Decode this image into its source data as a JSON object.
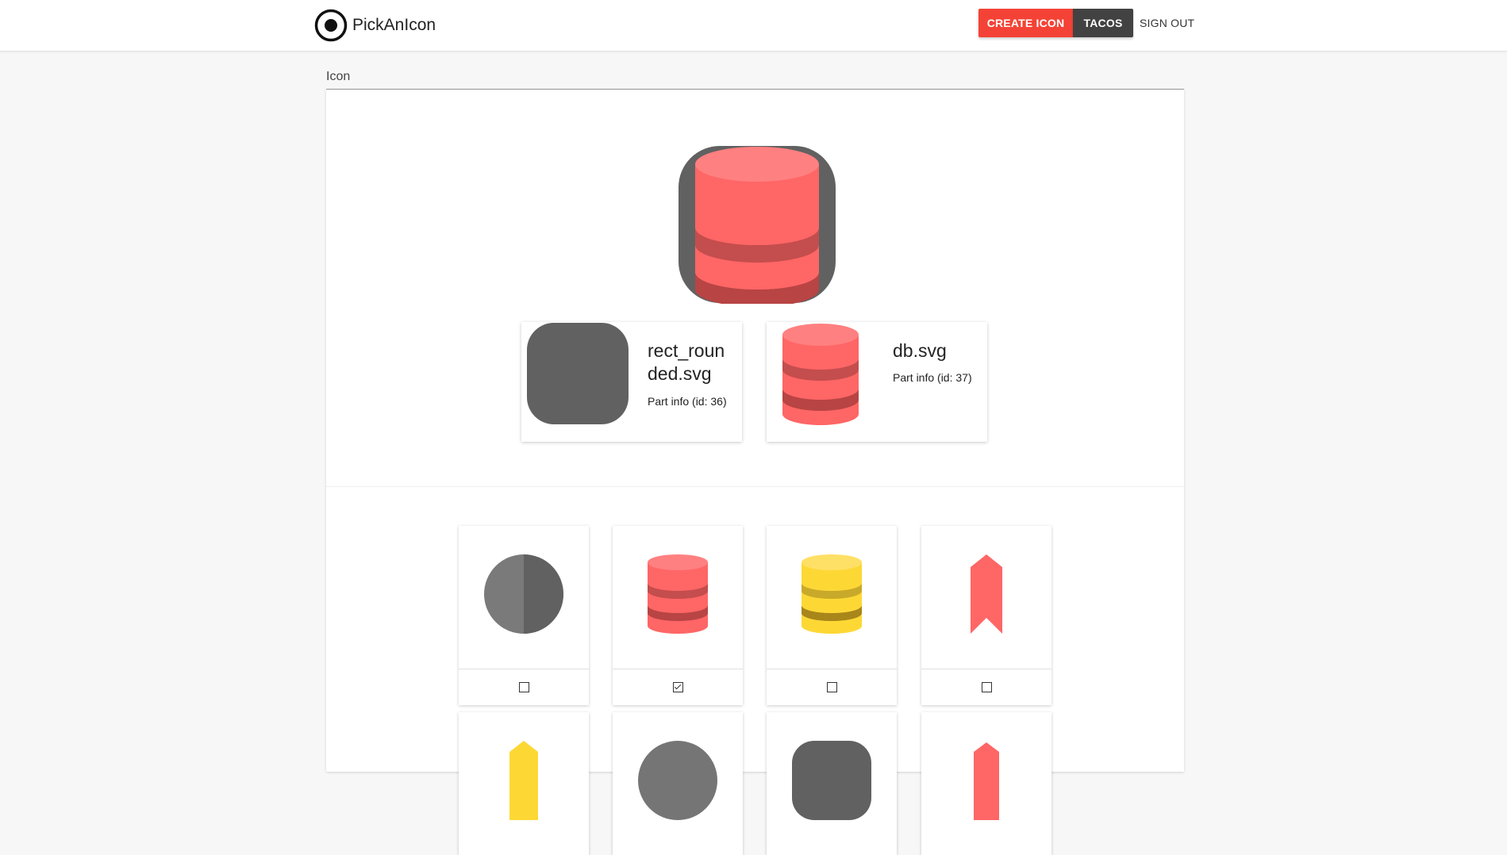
{
  "header": {
    "brand_name": "PickAnIcon",
    "create_label": "CREATE ICON",
    "tacos_label": "TACOS",
    "signout_label": "SIGN OUT"
  },
  "section": {
    "label": "Icon"
  },
  "parts": [
    {
      "name": "rect_rounded.svg",
      "info": "Part info (id: 36)",
      "icon": "rounded-square-icon"
    },
    {
      "name": "db.svg",
      "info": "Part info (id: 37)",
      "icon": "database-icon"
    }
  ],
  "gallery": [
    {
      "icon": "half-circle-icon",
      "checked": false
    },
    {
      "icon": "database-icon",
      "checked": true
    },
    {
      "icon": "database-yellow-icon",
      "checked": false
    },
    {
      "icon": "ribbon-icon",
      "checked": false
    },
    {
      "icon": "yellow-arrow-icon",
      "checked": false
    },
    {
      "icon": "gray-circle-icon",
      "checked": false
    },
    {
      "icon": "gray-rounded-square-icon",
      "checked": false
    },
    {
      "icon": "red-arrow-icon",
      "checked": false
    }
  ],
  "colors": {
    "accent": "#f44336",
    "dark": "#424242",
    "db_red": "#ff6666",
    "db_yellow": "#fdd835",
    "shape_gray": "#616161"
  }
}
